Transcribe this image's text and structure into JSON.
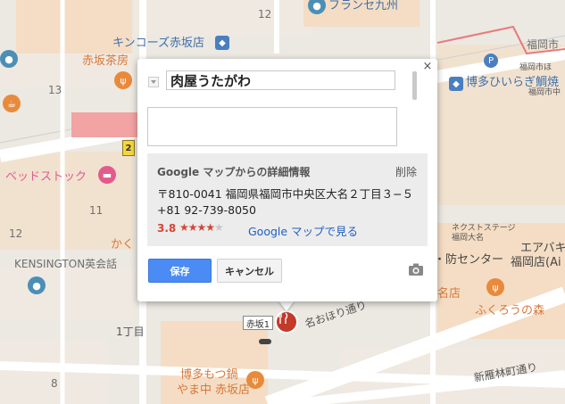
{
  "map": {
    "labels": {
      "block_12": "12",
      "block_13": "13",
      "block_11": "11",
      "block_12b": "12",
      "block_8": "8",
      "chome1": "1丁目",
      "france": "フランセ九州",
      "kingcoz": "キンコーズ赤坂店",
      "akasaka_sabo_1": "赤坂茶房",
      "bedstock": "ベッドストック",
      "kaku": "かく",
      "kensington": "KENSINGTON英会話",
      "fukuoka_city": "福岡市",
      "fukuoka_shi_ni": "福岡市中",
      "fukuoka_shi_ho": "福岡市ほ",
      "hakata_hiiragi": "博多ひいらぎ鯛焼",
      "nextstage": "ネクストステージ",
      "nextstage_2": "福岡大名",
      "bosai": "・防センター",
      "erabaki": "エアバキ",
      "fukuoka_ten": "福岡店(Ai",
      "meiten": "名店",
      "fukuro": "ふくろうの森",
      "meihohori": "名おほり通り",
      "shin_kareki": "新雁林町通り",
      "hakata_motsu": "博多もつ鍋",
      "yamanaka": "やま中 赤坂店",
      "akasaka1": "赤坂1",
      "badge_2": "2"
    },
    "icon_colors": {
      "restaurant": "#e88a3c",
      "lodging": "#e25b8c",
      "landmark": "#4c8fb5",
      "shopping": "#4a7fbf",
      "marker": "#c23a2a"
    }
  },
  "dialog": {
    "title_value": "肉屋うたがわ",
    "description_placeholder": "",
    "info_header": "Google マップからの詳細情報",
    "delete_label": "削除",
    "address": "〒810-0041 福岡県福岡市中央区大名２丁目３−５",
    "phone": "+81 92-739-8050",
    "rating": "3.8",
    "stars_filled": "★★★★",
    "stars_empty": "★",
    "view_in_maps": "Google マップで見る",
    "save_label": "保存",
    "cancel_label": "キャンセル",
    "close_glyph": "×"
  }
}
